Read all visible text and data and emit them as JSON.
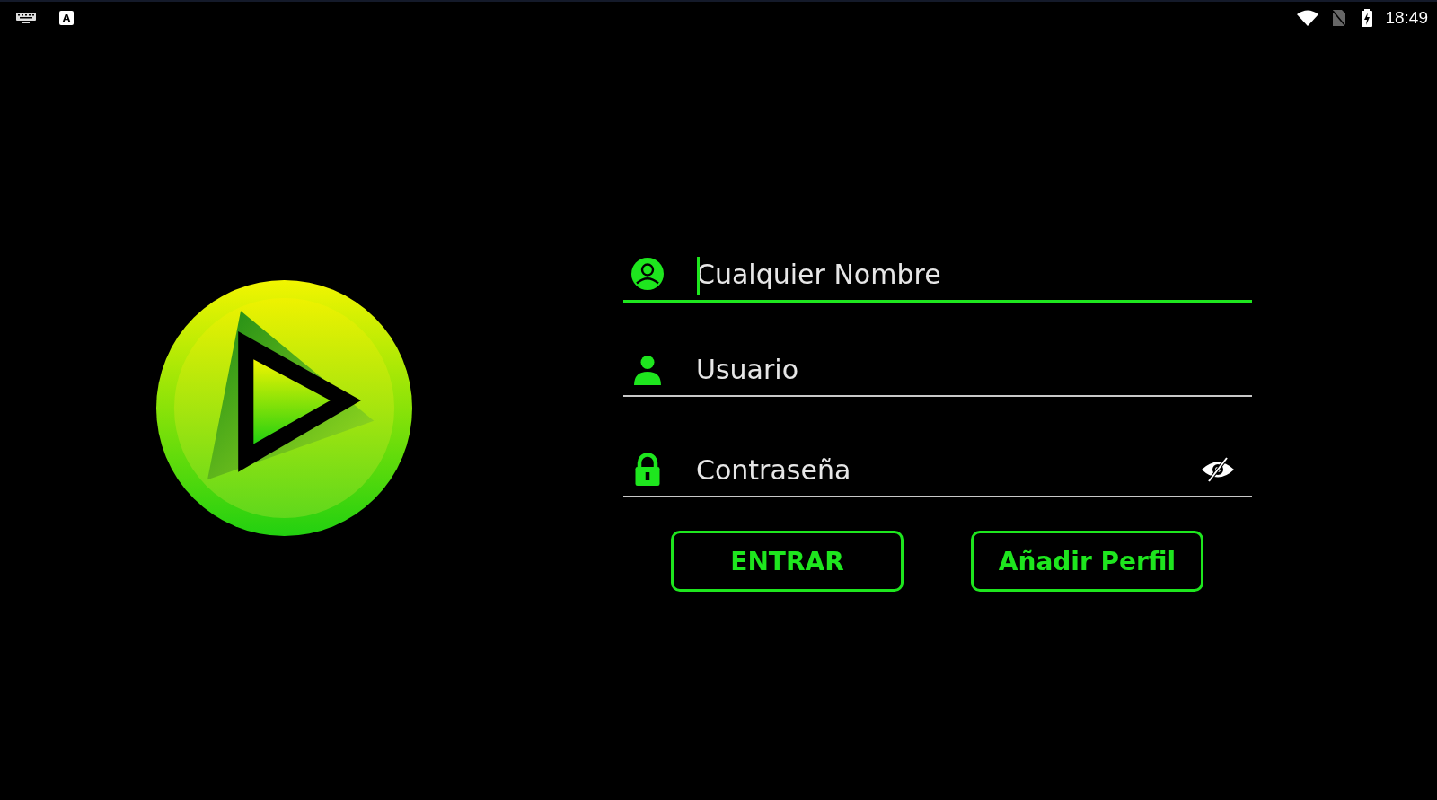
{
  "status_bar": {
    "app_badge": "A",
    "time": "18:49"
  },
  "fields": [
    {
      "kind": "name",
      "placeholder": "Cualquier Nombre",
      "focused": true
    },
    {
      "kind": "user",
      "placeholder": "Usuario",
      "focused": false
    },
    {
      "kind": "password",
      "placeholder": "Contraseña",
      "focused": false
    }
  ],
  "buttons": [
    "ENTRAR",
    "Añadir Perfil"
  ]
}
